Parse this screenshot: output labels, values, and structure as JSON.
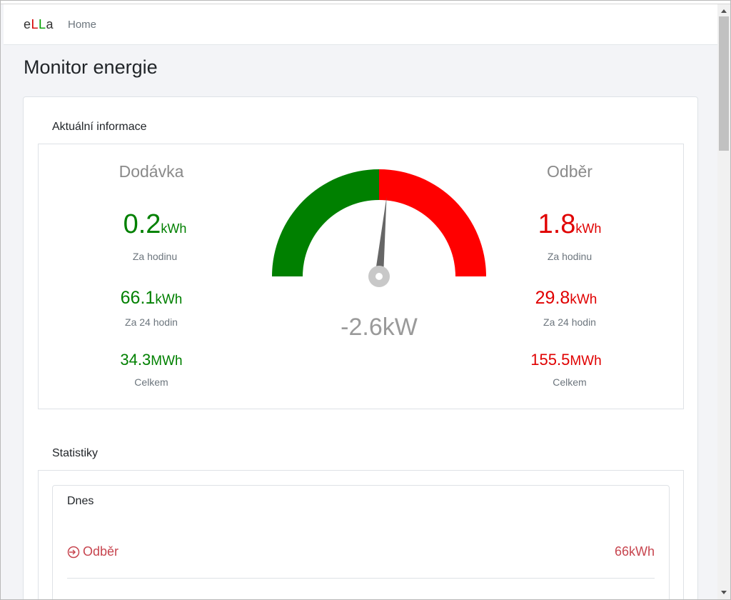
{
  "nav": {
    "brand_e": "e",
    "brand_l1": "L",
    "brand_l2": "L",
    "brand_a": "a",
    "home": "Home"
  },
  "page": {
    "title": "Monitor energie"
  },
  "current": {
    "section_title": "Aktuální informace",
    "supply": {
      "title": "Dodávka",
      "hour_value": "0.2",
      "hour_unit": "kWh",
      "hour_label": "Za hodinu",
      "day_value": "66.1",
      "day_unit": "kWh",
      "day_label": "Za 24 hodin",
      "total_value": "34.3",
      "total_unit": "MWh",
      "total_label": "Celkem"
    },
    "consumption": {
      "title": "Odběr",
      "hour_value": "1.8",
      "hour_unit": "kWh",
      "hour_label": "Za hodinu",
      "day_value": "29.8",
      "day_unit": "kWh",
      "day_label": "Za 24 hodin",
      "total_value": "155.5",
      "total_unit": "MWh",
      "total_label": "Celkem"
    },
    "gauge": {
      "value_text": "-2.6kW",
      "needle_fraction": 0.53,
      "left_color": "#008000",
      "right_color": "#ff0000"
    }
  },
  "stats": {
    "section_title": "Statistiky",
    "today": {
      "title": "Dnes",
      "row_icon": "sign-in-icon",
      "row_label": "Odběr",
      "row_value": "66kWh"
    }
  },
  "colors": {
    "supply": "#008000",
    "consumption": "#e00000",
    "stat_red": "#c7454f"
  }
}
